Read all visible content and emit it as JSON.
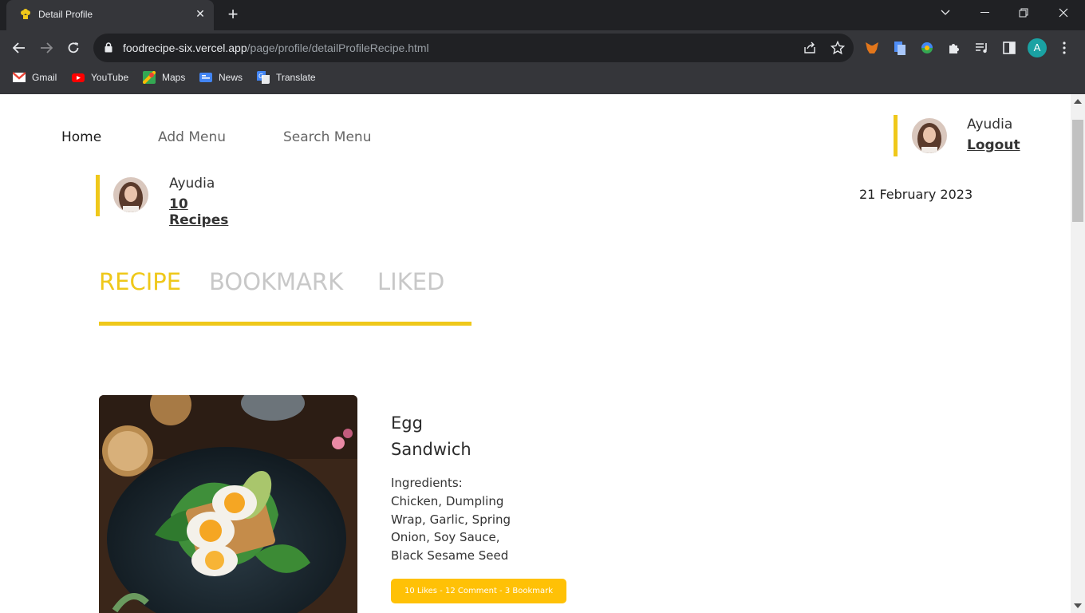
{
  "browser": {
    "tab_title": "Detail Profile",
    "url_host": "foodrecipe-six.vercel.app",
    "url_path": "/page/profile/detailProfileRecipe.html",
    "profile_initial": "A",
    "bookmarks": [
      {
        "label": "Gmail",
        "icon": "gmail-icon",
        "color": "#ea4335"
      },
      {
        "label": "YouTube",
        "icon": "youtube-icon",
        "color": "#ff0000"
      },
      {
        "label": "Maps",
        "icon": "maps-icon",
        "color": "#34a853"
      },
      {
        "label": "News",
        "icon": "news-icon",
        "color": "#4285f4"
      },
      {
        "label": "Translate",
        "icon": "translate-icon",
        "color": "#4285f4"
      }
    ]
  },
  "nav": {
    "home": "Home",
    "add_menu": "Add Menu",
    "search_menu": "Search Menu"
  },
  "user": {
    "name": "Ayudia",
    "logout": "Logout"
  },
  "profile": {
    "name": "Ayudia",
    "recipes_count": "10 Recipes",
    "date": "21 February 2023"
  },
  "tabs": {
    "recipe": "RECIPE",
    "bookmark": "BOOKMARK",
    "liked": "LIKED"
  },
  "recipe": {
    "title_line1": "Egg",
    "title_line2": "Sandwich",
    "ingredients_label": "Ingredients:",
    "ingredients_lines": [
      "Chicken, Dumpling",
      "Wrap, Garlic, Spring",
      "Onion, Soy Sauce,",
      "Black Sesame Seed"
    ],
    "stats": "10 Likes - 12 Comment - 3 Bookmark"
  },
  "colors": {
    "accent": "#efc81a",
    "stats_bg": "#ffc106"
  }
}
